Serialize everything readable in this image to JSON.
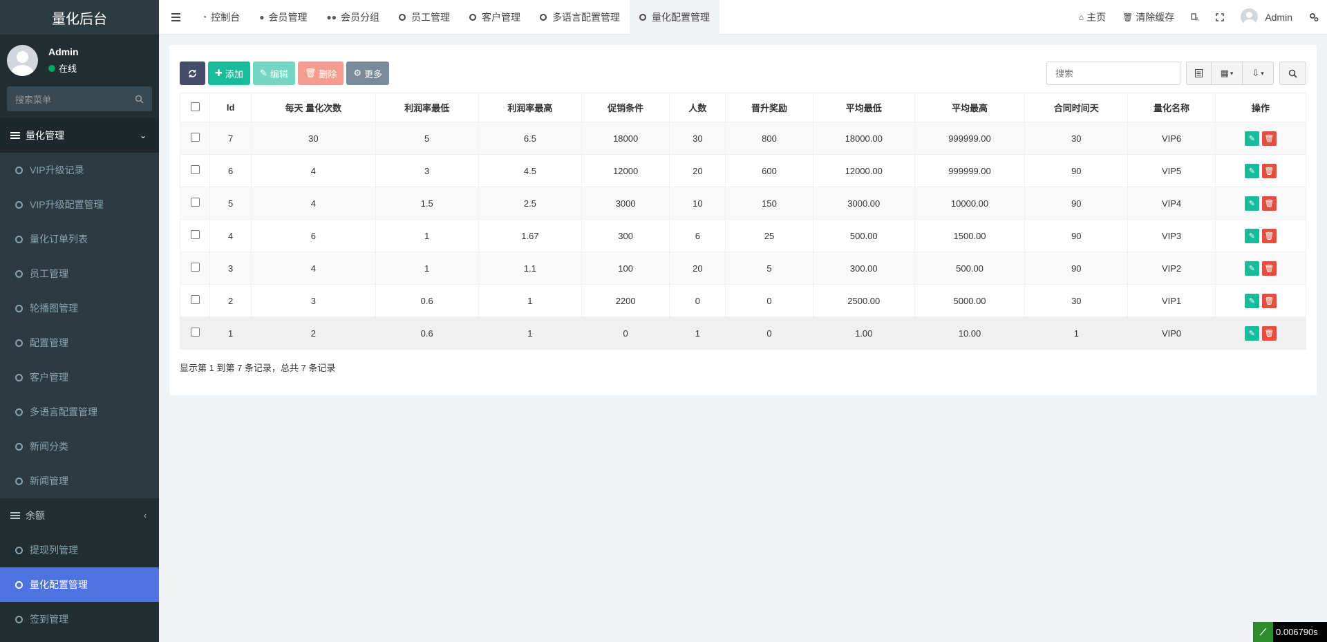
{
  "sidebar": {
    "brand": "量化后台",
    "user": {
      "name": "Admin",
      "status": "在线"
    },
    "search_placeholder": "搜索菜单",
    "menu_header": "量化管理",
    "items": [
      "VIP升级记录",
      "VIP升级配置管理",
      "量化订单列表",
      "员工管理",
      "轮播图管理",
      "配置管理",
      "客户管理",
      "多语言配置管理",
      "新闻分类",
      "新闻管理"
    ],
    "section2": "余额",
    "items2": [
      "提现列管理",
      "量化配置管理",
      "签到管理"
    ]
  },
  "topnav": {
    "tabs": [
      {
        "icon": "dashboard-icon",
        "glyph": "◔",
        "label": "控制台"
      },
      {
        "icon": "user-icon",
        "glyph": "●",
        "label": "会员管理"
      },
      {
        "icon": "users-icon",
        "glyph": "●●",
        "label": "会员分组"
      },
      {
        "icon": "circle-icon",
        "glyph": "",
        "label": "员工管理"
      },
      {
        "icon": "circle-icon",
        "glyph": "",
        "label": "客户管理"
      },
      {
        "icon": "circle-icon",
        "glyph": "",
        "label": "多语言配置管理"
      },
      {
        "icon": "circle-icon",
        "glyph": "",
        "label": "量化配置管理"
      }
    ],
    "home": "主页",
    "clear_cache": "清除缓存",
    "user": "Admin"
  },
  "toolbar": {
    "add": "添加",
    "edit": "编辑",
    "delete": "删除",
    "more": "更多",
    "search_placeholder": "搜索"
  },
  "table": {
    "headers": [
      "Id",
      "每天 量化次数",
      "利润率最低",
      "利润率最高",
      "促销条件",
      "人数",
      "晋升奖励",
      "平均最低",
      "平均最高",
      "合同时间天",
      "量化名称",
      "操作"
    ],
    "rows": [
      [
        "7",
        "30",
        "5",
        "6.5",
        "18000",
        "30",
        "800",
        "18000.00",
        "999999.00",
        "30",
        "VIP6"
      ],
      [
        "6",
        "4",
        "3",
        "4.5",
        "12000",
        "20",
        "600",
        "12000.00",
        "999999.00",
        "90",
        "VIP5"
      ],
      [
        "5",
        "4",
        "1.5",
        "2.5",
        "3000",
        "10",
        "150",
        "3000.00",
        "10000.00",
        "90",
        "VIP4"
      ],
      [
        "4",
        "6",
        "1",
        "1.67",
        "300",
        "6",
        "25",
        "500.00",
        "1500.00",
        "90",
        "VIP3"
      ],
      [
        "3",
        "4",
        "1",
        "1.1",
        "100",
        "20",
        "5",
        "300.00",
        "500.00",
        "90",
        "VIP2"
      ],
      [
        "2",
        "3",
        "0.6",
        "1",
        "2200",
        "0",
        "0",
        "2500.00",
        "5000.00",
        "30",
        "VIP1"
      ],
      [
        "1",
        "2",
        "0.6",
        "1",
        "0",
        "1",
        "0",
        "1.00",
        "10.00",
        "1",
        "VIP0"
      ]
    ]
  },
  "pager": "显示第 1 到第 7 条记录，总共 7 条记录",
  "perf": "0.006790s"
}
